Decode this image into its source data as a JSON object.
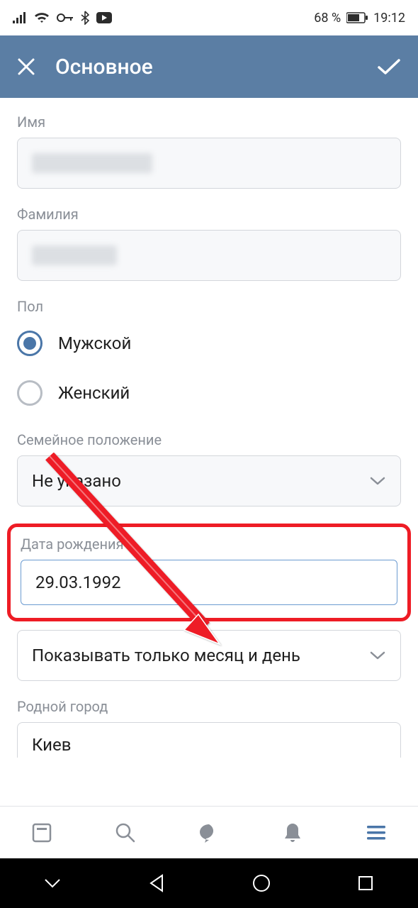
{
  "statusbar": {
    "battery_percent": "68 %",
    "time": "19:12"
  },
  "appbar": {
    "title": "Основное"
  },
  "form": {
    "name_label": "Имя",
    "surname_label": "Фамилия",
    "gender_label": "Пол",
    "gender_male": "Мужской",
    "gender_female": "Женский",
    "relationship_label": "Семейное положение",
    "relationship_value": "Не указано",
    "birthdate_label": "Дата рождения",
    "birthdate_value": "29.03.1992",
    "birthdate_visibility": "Показывать только месяц и день",
    "hometown_label": "Родной город",
    "hometown_value": "Киев"
  },
  "colors": {
    "appbar_bg": "#5b7ea4",
    "accent": "#4a76a8",
    "highlight_border": "#ee1c25"
  }
}
